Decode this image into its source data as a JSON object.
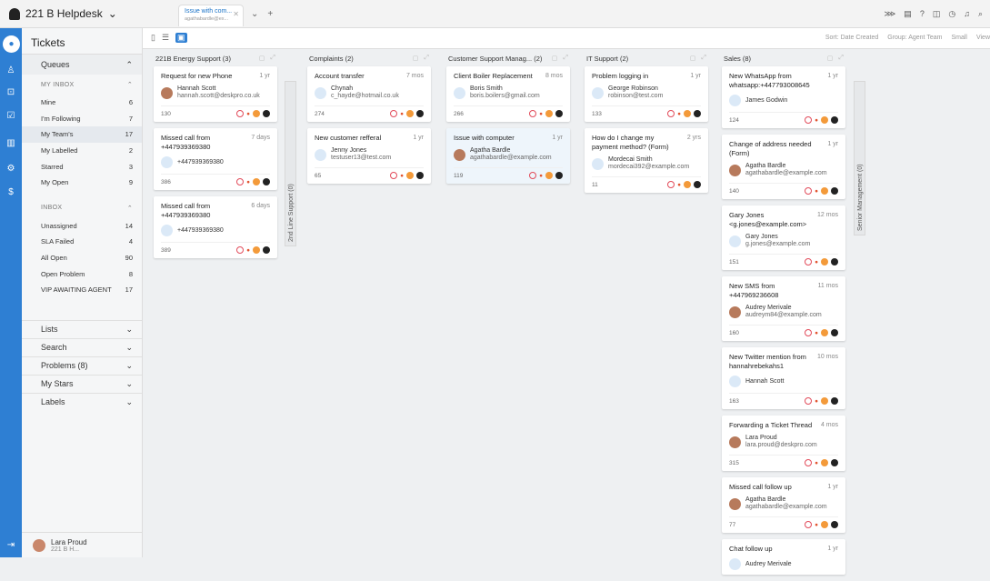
{
  "app": {
    "brand": "221 B Helpdesk",
    "tab_title": "Issue with com...",
    "tab_sub": "agathabardle@ex..."
  },
  "sidebar": {
    "title": "Tickets",
    "queues": "Queues",
    "my_inbox": "MY INBOX",
    "inbox_items": [
      {
        "label": "Mine",
        "count": "6"
      },
      {
        "label": "I'm Following",
        "count": "7"
      },
      {
        "label": "My Team's",
        "count": "17"
      },
      {
        "label": "My Labelled",
        "count": "2"
      },
      {
        "label": "Starred",
        "count": "3"
      },
      {
        "label": "My Open",
        "count": "9"
      }
    ],
    "inbox": "INBOX",
    "inbox2_items": [
      {
        "label": "Unassigned",
        "count": "14"
      },
      {
        "label": "SLA Failed",
        "count": "4"
      },
      {
        "label": "All Open",
        "count": "90"
      },
      {
        "label": "Open Problem",
        "count": "8"
      },
      {
        "label": "VIP AWAITING AGENT",
        "count": "17"
      }
    ],
    "sections": [
      "Lists",
      "Search",
      "Problems (8)",
      "My Stars",
      "Labels"
    ],
    "user": {
      "name": "Lara Proud",
      "team": "221 B H..."
    }
  },
  "toolbar": {
    "sort": "Sort: Date Created",
    "group": "Group: Agent Team",
    "size": "Small",
    "view": "View"
  },
  "columns": [
    {
      "title": "221B Energy Support (3)",
      "cards": [
        {
          "title": "Request for new Phone",
          "age": "1 yr",
          "name": "Hannah Scott",
          "email": "hannah.scott@deskpro.co.uk",
          "id": "130"
        },
        {
          "title": "Missed call from +447939369380",
          "age": "7 days",
          "name": "+447939369380",
          "email": "",
          "id": "386"
        },
        {
          "title": "Missed call from +447939369380",
          "age": "6 days",
          "name": "+447939369380",
          "email": "",
          "id": "389"
        }
      ]
    },
    {
      "title": "Complaints (2)",
      "cards": [
        {
          "title": "Account transfer",
          "age": "7 mos",
          "name": "Chynah",
          "email": "c_hayde@hotmail.co.uk",
          "id": "274"
        },
        {
          "title": "New customer refferal",
          "age": "1 yr",
          "name": "Jenny Jones",
          "email": "testuser13@test.com",
          "id": "65"
        }
      ]
    },
    {
      "title": "Customer Support Manag... (2)",
      "cards": [
        {
          "title": "Client Boiler Replacement",
          "age": "8 mos",
          "name": "Boris Smith",
          "email": "boris.boilers@gmail.com",
          "id": "266"
        },
        {
          "title": "Issue with computer",
          "age": "1 yr",
          "name": "Agatha Bardle",
          "email": "agathabardle@example.com",
          "id": "119"
        }
      ]
    },
    {
      "title": "IT Support (2)",
      "cards": [
        {
          "title": "Problem logging in",
          "age": "1 yr",
          "name": "George Robinson",
          "email": "robinson@test.com",
          "id": "133"
        },
        {
          "title": "How do I change my payment method? (Form)",
          "age": "2 yrs",
          "name": "Mordecai Smith",
          "email": "mordecai392@example.com",
          "id": "11"
        }
      ]
    },
    {
      "title": "Sales (8)",
      "cards": [
        {
          "title": "New WhatsApp from whatsapp:+447793008645",
          "age": "1 yr",
          "name": "James Godwin",
          "email": "",
          "id": "124"
        },
        {
          "title": "Change of address needed (Form)",
          "age": "1 yr",
          "name": "Agatha Bardle",
          "email": "agathabardle@example.com",
          "id": "140"
        },
        {
          "title": "Gary Jones <g.jones@example.com>",
          "age": "12 mos",
          "name": "Gary Jones",
          "email": "g.jones@example.com",
          "id": "151"
        },
        {
          "title": "New SMS from +447969236608",
          "age": "11 mos",
          "name": "Audrey Merivale",
          "email": "audreym84@example.com",
          "id": "160"
        },
        {
          "title": "New Twitter mention from hannahrebekahs1",
          "age": "10 mos",
          "name": "Hannah Scott",
          "email": "",
          "id": "163"
        },
        {
          "title": "Forwarding a Ticket Thread",
          "age": "4 mos",
          "name": "Lara Proud",
          "email": "lara.proud@deskpro.com",
          "id": "315"
        },
        {
          "title": "Missed call follow up",
          "age": "1 yr",
          "name": "Agatha Bardle",
          "email": "agathabardle@example.com",
          "id": "77"
        },
        {
          "title": "Chat follow up",
          "age": "1 yr",
          "name": "Audrey Merivale",
          "email": "",
          "id": ""
        }
      ]
    }
  ],
  "collapsed": [
    "2nd Line Support (0)",
    "Senior Management (0)"
  ]
}
